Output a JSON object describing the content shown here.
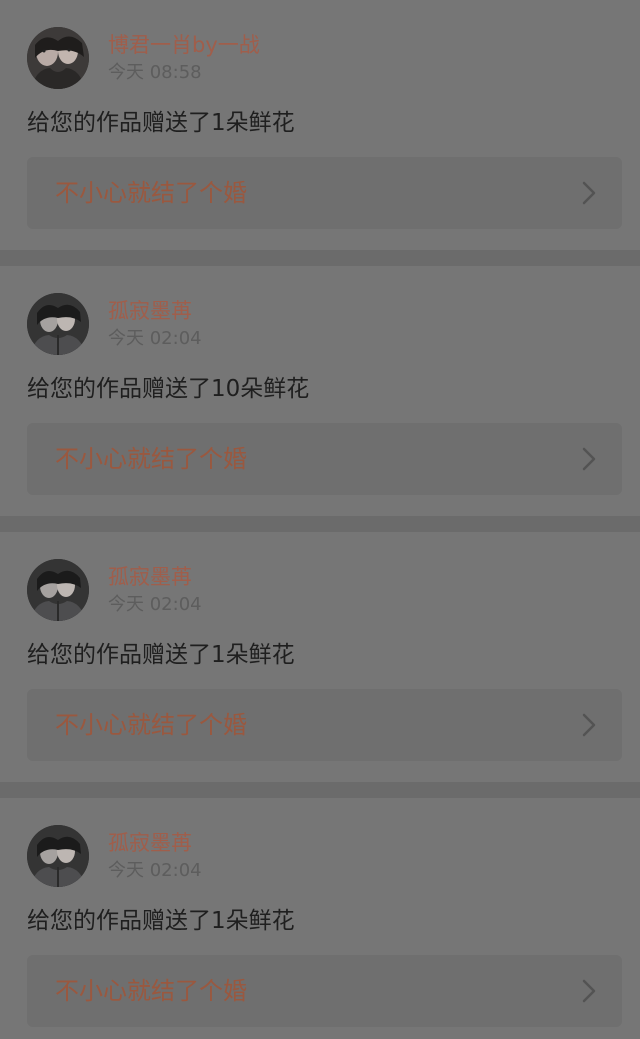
{
  "notifications": [
    {
      "username": "博君一肖by一战",
      "time": "今天 08:58",
      "message": "给您的作品赠送了1朵鲜花",
      "work_title": "不小心就结了个婚"
    },
    {
      "username": "孤寂墨苒",
      "time": "今天 02:04",
      "message": "给您的作品赠送了10朵鲜花",
      "work_title": "不小心就结了个婚"
    },
    {
      "username": "孤寂墨苒",
      "time": "今天 02:04",
      "message": "给您的作品赠送了1朵鲜花",
      "work_title": "不小心就结了个婚"
    },
    {
      "username": "孤寂墨苒",
      "time": "今天 02:04",
      "message": "给您的作品赠送了1朵鲜花",
      "work_title": "不小心就结了个婚"
    }
  ],
  "icons": {
    "work_link": "chevron-right-icon"
  },
  "colors": {
    "username": "#a05e4b",
    "work_title": "#9a583f",
    "message": "#1f1f1f",
    "time": "#5d5d5d"
  }
}
